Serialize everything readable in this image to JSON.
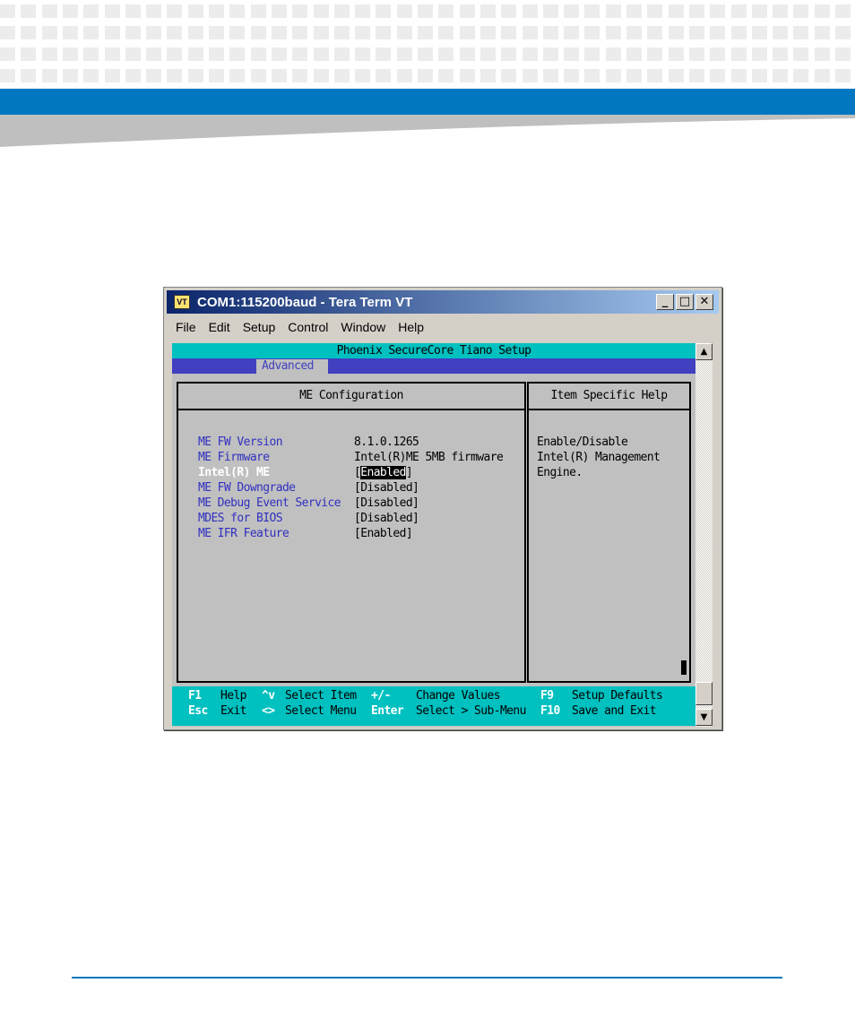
{
  "window": {
    "icon_label": "VT",
    "title": "COM1:115200baud - Tera Term VT",
    "controls": {
      "minimize": "_",
      "maximize": "□",
      "close": "✕"
    }
  },
  "menubar": [
    "File",
    "Edit",
    "Setup",
    "Control",
    "Window",
    "Help"
  ],
  "bios": {
    "title": "Phoenix SecureCore Tiano Setup",
    "active_tab": "Advanced",
    "panel_title": "ME Configuration",
    "help_title": "Item Specific Help",
    "settings": [
      {
        "label": "ME FW Version",
        "value": "8.1.0.1265"
      },
      {
        "label": "ME Firmware",
        "value": "Intel(R)ME 5MB firmware"
      },
      {
        "label": "Intel(R) ME",
        "value_prefix": "[",
        "value_highlight": "Enabled",
        "value_suffix": "]"
      },
      {
        "label": "ME FW Downgrade",
        "value": "[Disabled]"
      },
      {
        "label": "ME Debug Event Service",
        "value": "[Disabled]"
      },
      {
        "label": "MDES for BIOS",
        "value": "[Disabled]"
      },
      {
        "label": "ME IFR Feature",
        "value": "[Enabled]"
      }
    ],
    "help_text": [
      "Enable/Disable",
      "Intel(R) Management",
      "Engine."
    ],
    "status": {
      "row1": [
        {
          "key": "F1",
          "text": "Help"
        },
        {
          "key": "^v",
          "text": "Select Item"
        },
        {
          "key": "+/-",
          "text": "Change Values"
        },
        {
          "key": "F9",
          "text": "Setup Defaults"
        }
      ],
      "row2": [
        {
          "key": "Esc",
          "text": "Exit"
        },
        {
          "key": "<>",
          "text": "Select Menu"
        },
        {
          "key": "Enter",
          "text": "Select > Sub-Menu"
        },
        {
          "key": "F10",
          "text": "Save and Exit"
        }
      ]
    }
  },
  "scrollbar": {
    "up": "▲",
    "down": "▼"
  },
  "colors": {
    "brand_blue": "#0077c0",
    "bios_cyan": "#00c0c0",
    "bios_blue": "#4040c0"
  }
}
